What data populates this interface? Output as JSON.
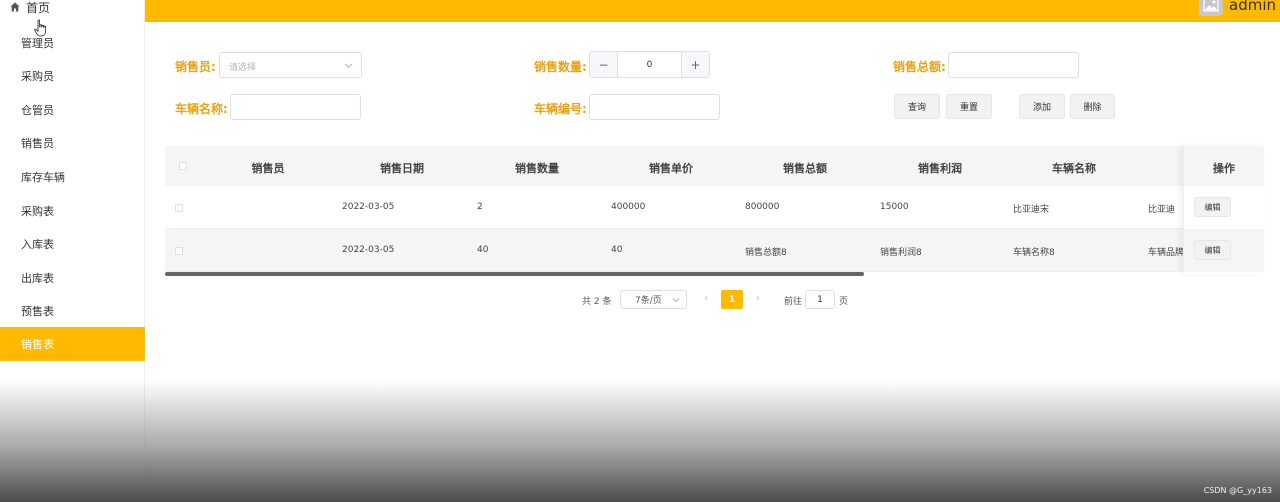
{
  "sidebar": {
    "home_label": "首页",
    "items": [
      {
        "label": "管理员"
      },
      {
        "label": "采购员"
      },
      {
        "label": "仓管员"
      },
      {
        "label": "销售员"
      },
      {
        "label": "库存车辆"
      },
      {
        "label": "采购表"
      },
      {
        "label": "入库表"
      },
      {
        "label": "出库表"
      },
      {
        "label": "预售表"
      },
      {
        "label": "销售表",
        "active": true
      }
    ]
  },
  "header": {
    "user_name": "admin",
    "accent_color": "#ffba00"
  },
  "form": {
    "salesperson_label": "销售员:",
    "salesperson_placeholder": "请选择",
    "quantity_label": "销售数量:",
    "quantity_value": "0",
    "stepper_minus": "−",
    "stepper_plus": "+",
    "total_label": "销售总额:",
    "vehicle_name_label": "车辆名称:",
    "vehicle_code_label": "车辆编号:",
    "query_btn": "查询",
    "reset_btn": "重置",
    "add_btn": "添加",
    "delete_btn": "删除"
  },
  "table": {
    "columns": [
      "销售员",
      "销售日期",
      "销售数量",
      "销售单价",
      "销售总额",
      "销售利润",
      "车辆名称",
      "操作"
    ],
    "rows": [
      {
        "salesperson": "",
        "date": "2022-03-05",
        "quantity": "2",
        "unit_price": "400000",
        "total": "800000",
        "profit": "15000",
        "vehicle_name": "比亚迪宋",
        "brand": "比亚迪",
        "action": "编辑"
      },
      {
        "salesperson": "",
        "date": "2022-03-05",
        "quantity": "40",
        "unit_price": "40",
        "total": "销售总额8",
        "profit": "销售利润8",
        "vehicle_name": "车辆名称8",
        "brand": "车辆品牌",
        "action": "编辑"
      }
    ]
  },
  "pagination": {
    "total": "共 2 条",
    "page_size": "7条/页",
    "current_page": "1",
    "goto_label": "前往",
    "goto_value": "1",
    "page_suffix": "页",
    "prev": "‹",
    "next": "›"
  },
  "watermark": "CSDN @G_yy163"
}
